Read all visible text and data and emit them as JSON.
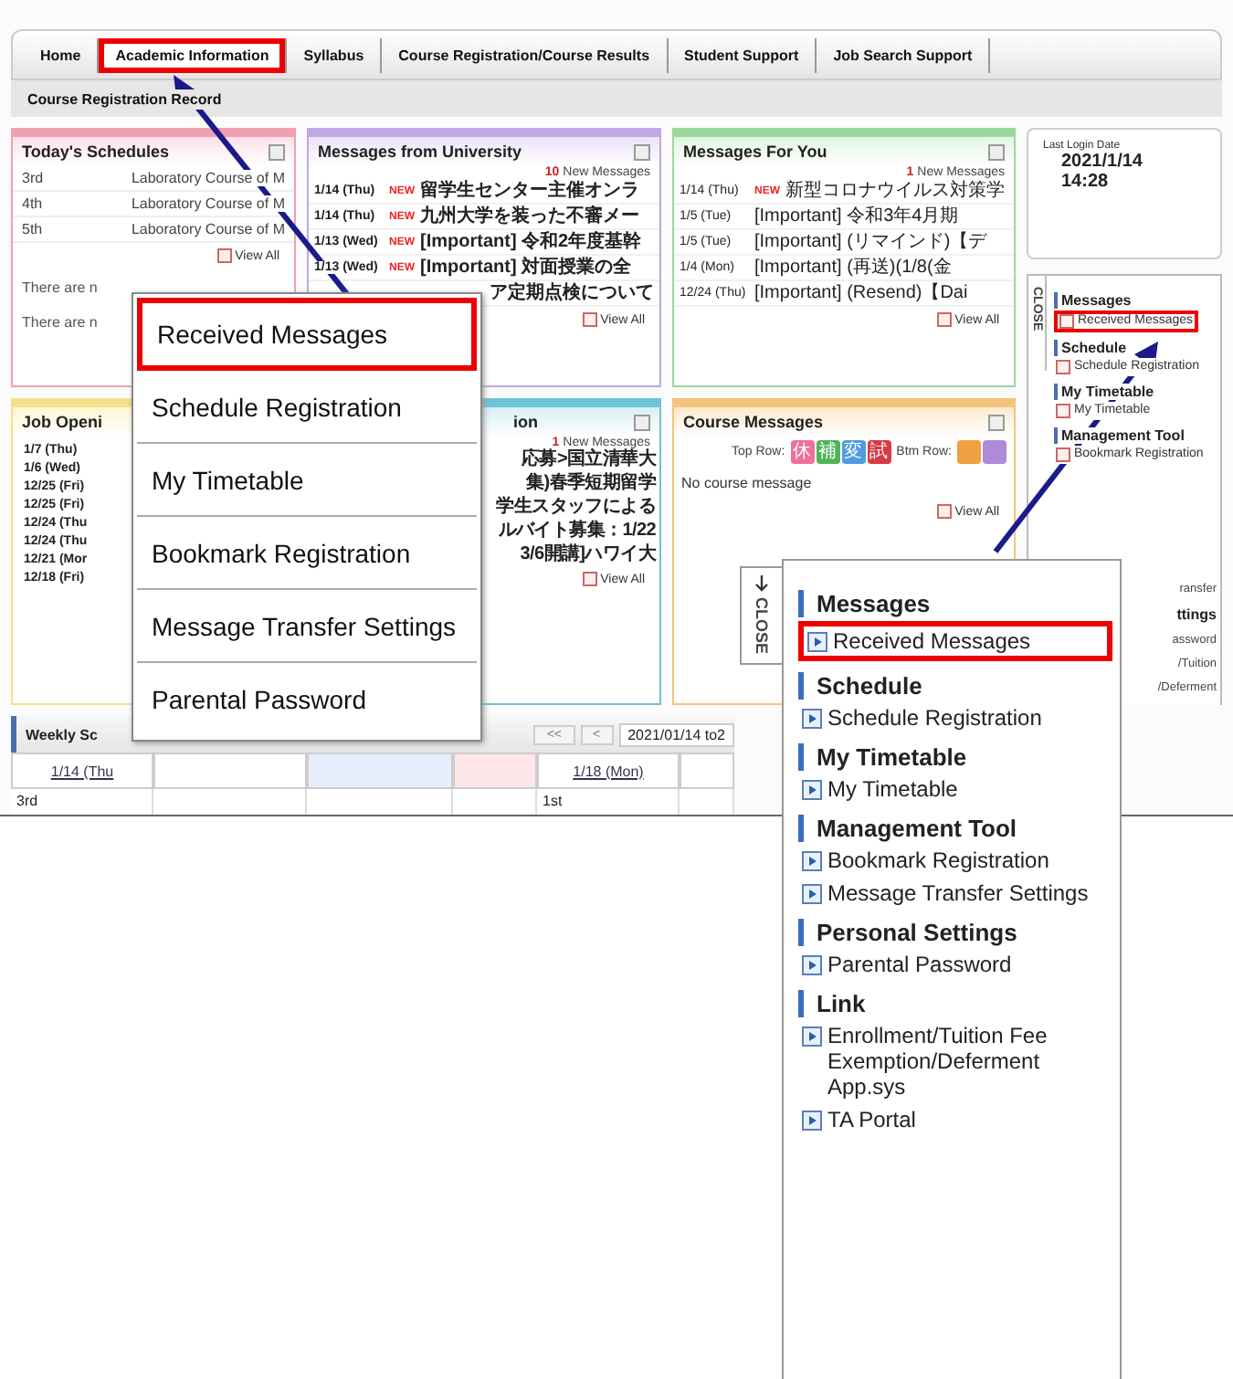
{
  "nav": {
    "tabs": [
      {
        "label": "Home",
        "highlighted": false
      },
      {
        "label": "Academic Information",
        "highlighted": true
      },
      {
        "label": "Syllabus",
        "highlighted": false
      },
      {
        "label": "Course Registration/Course Results",
        "highlighted": false
      },
      {
        "label": "Student Support",
        "highlighted": false
      },
      {
        "label": "Job Search Support",
        "highlighted": false
      }
    ],
    "second_row": "Course Registration Record"
  },
  "today": {
    "title": "Today's Schedules",
    "rows": [
      {
        "period": "3rd",
        "course": "Laboratory Course of M"
      },
      {
        "period": "4th",
        "course": "Laboratory Course of M"
      },
      {
        "period": "5th",
        "course": "Laboratory Course of M"
      }
    ],
    "view_all": "View All",
    "notes": [
      "There are n",
      "There are n"
    ]
  },
  "univ": {
    "title": "Messages from University",
    "count": "10",
    "count_label": "New Messages",
    "rows": [
      {
        "date": "1/14 (Thu)",
        "badge": "NEW",
        "text": "留学生センター主催オンラ"
      },
      {
        "date": "1/14 (Thu)",
        "badge": "NEW",
        "text": "九州大学を装った不審メー"
      },
      {
        "date": "1/13 (Wed)",
        "badge": "NEW",
        "text": "[Important] 令和2年度基幹"
      },
      {
        "date": "1/13 (Wed)",
        "badge": "NEW",
        "text": "[Important] 対面授業の全"
      }
    ],
    "tail": "ア定期点検について",
    "view_all": "View All"
  },
  "you": {
    "title": "Messages For You",
    "count": "1",
    "count_label": "New Messages",
    "rows": [
      {
        "date": "1/14 (Thu)",
        "badge": "NEW",
        "text": "新型コロナウイルス対策学"
      },
      {
        "date": "1/5 (Tue)",
        "text": "[Important] 令和3年4月期"
      },
      {
        "date": "1/5 (Tue)",
        "text": "[Important] (リマインド)【デ"
      },
      {
        "date": "1/4 (Mon)",
        "text": "[Important] (再送)(1/8(金"
      },
      {
        "date": "12/24 (Thu)",
        "text": "[Important] (Resend)【Dai"
      }
    ],
    "view_all": "View All"
  },
  "login": {
    "label": "Last Login Date",
    "date": "2021/1/14",
    "time": "14:28"
  },
  "side": {
    "close": "CLOSE",
    "sections": [
      {
        "title": "Messages",
        "items": [
          {
            "label": "Received Messages",
            "highlighted": true
          }
        ]
      },
      {
        "title": "Schedule",
        "items": [
          {
            "label": "Schedule Registration",
            "highlighted": false
          }
        ]
      },
      {
        "title": "My Timetable",
        "items": [
          {
            "label": "My Timetable",
            "highlighted": false
          }
        ]
      },
      {
        "title": "Management Tool",
        "items": [
          {
            "label": "Bookmark Registration",
            "highlighted": false
          }
        ]
      }
    ],
    "fragments": [
      {
        "text": "ransfer",
        "kind": "item"
      },
      {
        "text": "ttings",
        "kind": "header"
      },
      {
        "text": "assword",
        "kind": "item"
      },
      {
        "text": "/Tuition",
        "kind": "item"
      },
      {
        "text": "/Deferment",
        "kind": "item"
      }
    ]
  },
  "jobs": {
    "title": "Job Openi",
    "dates": [
      "1/7 (Thu)",
      "1/6 (Wed)",
      "12/25 (Fri)",
      "12/25 (Fri)",
      "12/24 (Thu",
      "12/24 (Thu",
      "12/21 (Mor",
      "12/18 (Fri)"
    ]
  },
  "mid": {
    "title": "ion",
    "count": "1",
    "count_label": "New Messages",
    "rows": [
      "応募>国立清華大",
      "集)春季短期留学",
      "学生スタッフによる",
      "ルバイト募集：1/22",
      "3/6開講]ハワイ大"
    ],
    "view_all": "View All"
  },
  "course": {
    "title": "Course Messages",
    "top_label": "Top Row:",
    "top_tags": [
      {
        "text": "休",
        "color": "#ee6f9c"
      },
      {
        "text": "補",
        "color": "#4fb35a"
      },
      {
        "text": "変",
        "color": "#4f9be0"
      },
      {
        "text": "試",
        "color": "#d83a48"
      }
    ],
    "btm_label": "Btm Row:",
    "btm_tags": [
      {
        "color": "#f0a040"
      },
      {
        "color": "#b08ad8"
      }
    ],
    "empty": "No course message",
    "view_all": "View All"
  },
  "weekly": {
    "title": "Weekly Sc",
    "first": "<<",
    "prev": "<",
    "range": "2021/01/14 to2",
    "columns": [
      {
        "label": "1/14 (Thu",
        "color": "#ffffff"
      },
      {
        "color": "#ffffff"
      },
      {
        "color": "#e6eefc"
      },
      {
        "color": "#fde6ea"
      },
      {
        "label": "1/18 (Mon)",
        "color": "#ffffff"
      }
    ],
    "row": [
      "3rd",
      "1st"
    ]
  },
  "menu": {
    "items": [
      {
        "label": "Received Messages",
        "highlighted": true
      },
      {
        "label": "Schedule Registration",
        "highlighted": false
      },
      {
        "label": "My Timetable",
        "highlighted": false
      },
      {
        "label": "Bookmark Registration",
        "highlighted": false
      },
      {
        "label": "Message Transfer Settings",
        "highlighted": false
      },
      {
        "label": "Parental Password",
        "highlighted": false
      }
    ]
  },
  "panel": {
    "close": "CLOSE",
    "sections": [
      {
        "title": "Messages",
        "items": [
          {
            "label": "Received Messages",
            "highlighted": true
          }
        ]
      },
      {
        "title": "Schedule",
        "items": [
          {
            "label": "Schedule Registration",
            "highlighted": false
          }
        ]
      },
      {
        "title": "My Timetable",
        "items": [
          {
            "label": "My Timetable",
            "highlighted": false
          }
        ]
      },
      {
        "title": "Management Tool",
        "items": [
          {
            "label": "Bookmark Registration",
            "highlighted": false
          },
          {
            "label": "Message Transfer Settings",
            "highlighted": false
          }
        ]
      },
      {
        "title": "Personal Settings",
        "items": [
          {
            "label": "Parental Password",
            "highlighted": false
          }
        ]
      },
      {
        "title": "Link",
        "items": [
          {
            "label": "Enrollment/Tuition Fee Exemption/Deferment App.sys",
            "highlighted": false
          },
          {
            "label": "TA Portal",
            "highlighted": false
          }
        ]
      }
    ]
  }
}
